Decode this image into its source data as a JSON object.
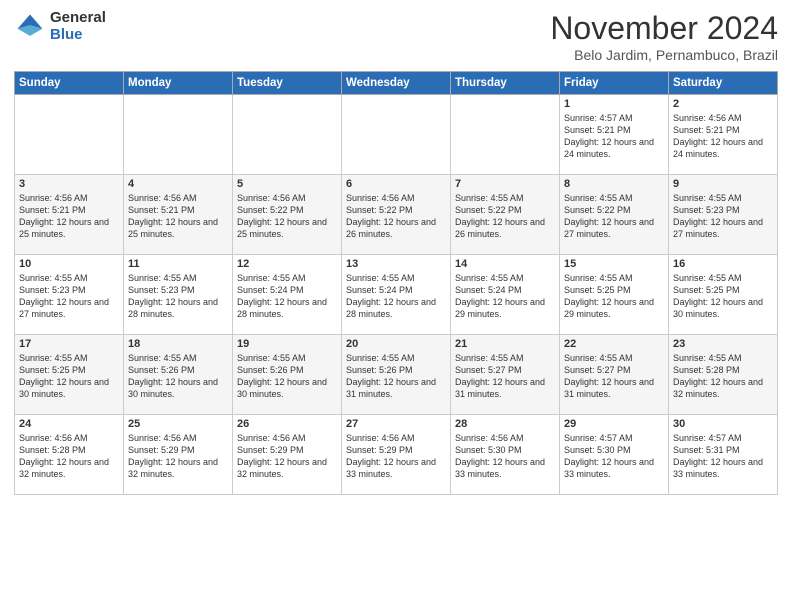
{
  "header": {
    "logo": {
      "general": "General",
      "blue": "Blue"
    },
    "title": "November 2024",
    "location": "Belo Jardim, Pernambuco, Brazil"
  },
  "days_header": [
    "Sunday",
    "Monday",
    "Tuesday",
    "Wednesday",
    "Thursday",
    "Friday",
    "Saturday"
  ],
  "weeks": [
    [
      {
        "day": "",
        "info": ""
      },
      {
        "day": "",
        "info": ""
      },
      {
        "day": "",
        "info": ""
      },
      {
        "day": "",
        "info": ""
      },
      {
        "day": "",
        "info": ""
      },
      {
        "day": "1",
        "info": "Sunrise: 4:57 AM\nSunset: 5:21 PM\nDaylight: 12 hours and 24 minutes."
      },
      {
        "day": "2",
        "info": "Sunrise: 4:56 AM\nSunset: 5:21 PM\nDaylight: 12 hours and 24 minutes."
      }
    ],
    [
      {
        "day": "3",
        "info": "Sunrise: 4:56 AM\nSunset: 5:21 PM\nDaylight: 12 hours and 25 minutes."
      },
      {
        "day": "4",
        "info": "Sunrise: 4:56 AM\nSunset: 5:21 PM\nDaylight: 12 hours and 25 minutes."
      },
      {
        "day": "5",
        "info": "Sunrise: 4:56 AM\nSunset: 5:22 PM\nDaylight: 12 hours and 25 minutes."
      },
      {
        "day": "6",
        "info": "Sunrise: 4:56 AM\nSunset: 5:22 PM\nDaylight: 12 hours and 26 minutes."
      },
      {
        "day": "7",
        "info": "Sunrise: 4:55 AM\nSunset: 5:22 PM\nDaylight: 12 hours and 26 minutes."
      },
      {
        "day": "8",
        "info": "Sunrise: 4:55 AM\nSunset: 5:22 PM\nDaylight: 12 hours and 27 minutes."
      },
      {
        "day": "9",
        "info": "Sunrise: 4:55 AM\nSunset: 5:23 PM\nDaylight: 12 hours and 27 minutes."
      }
    ],
    [
      {
        "day": "10",
        "info": "Sunrise: 4:55 AM\nSunset: 5:23 PM\nDaylight: 12 hours and 27 minutes."
      },
      {
        "day": "11",
        "info": "Sunrise: 4:55 AM\nSunset: 5:23 PM\nDaylight: 12 hours and 28 minutes."
      },
      {
        "day": "12",
        "info": "Sunrise: 4:55 AM\nSunset: 5:24 PM\nDaylight: 12 hours and 28 minutes."
      },
      {
        "day": "13",
        "info": "Sunrise: 4:55 AM\nSunset: 5:24 PM\nDaylight: 12 hours and 28 minutes."
      },
      {
        "day": "14",
        "info": "Sunrise: 4:55 AM\nSunset: 5:24 PM\nDaylight: 12 hours and 29 minutes."
      },
      {
        "day": "15",
        "info": "Sunrise: 4:55 AM\nSunset: 5:25 PM\nDaylight: 12 hours and 29 minutes."
      },
      {
        "day": "16",
        "info": "Sunrise: 4:55 AM\nSunset: 5:25 PM\nDaylight: 12 hours and 30 minutes."
      }
    ],
    [
      {
        "day": "17",
        "info": "Sunrise: 4:55 AM\nSunset: 5:25 PM\nDaylight: 12 hours and 30 minutes."
      },
      {
        "day": "18",
        "info": "Sunrise: 4:55 AM\nSunset: 5:26 PM\nDaylight: 12 hours and 30 minutes."
      },
      {
        "day": "19",
        "info": "Sunrise: 4:55 AM\nSunset: 5:26 PM\nDaylight: 12 hours and 30 minutes."
      },
      {
        "day": "20",
        "info": "Sunrise: 4:55 AM\nSunset: 5:26 PM\nDaylight: 12 hours and 31 minutes."
      },
      {
        "day": "21",
        "info": "Sunrise: 4:55 AM\nSunset: 5:27 PM\nDaylight: 12 hours and 31 minutes."
      },
      {
        "day": "22",
        "info": "Sunrise: 4:55 AM\nSunset: 5:27 PM\nDaylight: 12 hours and 31 minutes."
      },
      {
        "day": "23",
        "info": "Sunrise: 4:55 AM\nSunset: 5:28 PM\nDaylight: 12 hours and 32 minutes."
      }
    ],
    [
      {
        "day": "24",
        "info": "Sunrise: 4:56 AM\nSunset: 5:28 PM\nDaylight: 12 hours and 32 minutes."
      },
      {
        "day": "25",
        "info": "Sunrise: 4:56 AM\nSunset: 5:29 PM\nDaylight: 12 hours and 32 minutes."
      },
      {
        "day": "26",
        "info": "Sunrise: 4:56 AM\nSunset: 5:29 PM\nDaylight: 12 hours and 32 minutes."
      },
      {
        "day": "27",
        "info": "Sunrise: 4:56 AM\nSunset: 5:29 PM\nDaylight: 12 hours and 33 minutes."
      },
      {
        "day": "28",
        "info": "Sunrise: 4:56 AM\nSunset: 5:30 PM\nDaylight: 12 hours and 33 minutes."
      },
      {
        "day": "29",
        "info": "Sunrise: 4:57 AM\nSunset: 5:30 PM\nDaylight: 12 hours and 33 minutes."
      },
      {
        "day": "30",
        "info": "Sunrise: 4:57 AM\nSunset: 5:31 PM\nDaylight: 12 hours and 33 minutes."
      }
    ]
  ]
}
